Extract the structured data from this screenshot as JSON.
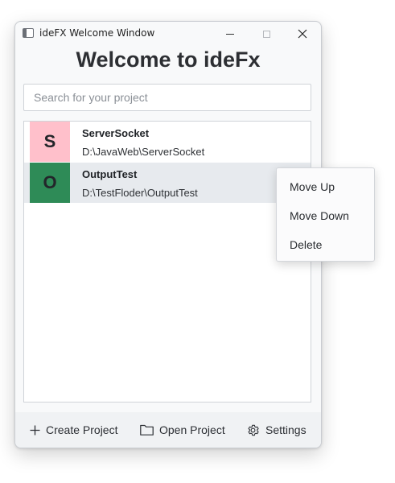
{
  "window": {
    "title": "ideFX Welcome Window",
    "heading": "Welcome to ideFx"
  },
  "search": {
    "placeholder": "Search for your project",
    "value": ""
  },
  "projects": [
    {
      "letter": "S",
      "name": "ServerSocket",
      "path": "D:\\JavaWeb\\ServerSocket",
      "color": "#ffc0cb"
    },
    {
      "letter": "O",
      "name": "OutputTest",
      "path": "D:\\TestFloder\\OutputTest",
      "color": "#2e8b57"
    }
  ],
  "context_menu": {
    "items": [
      "Move Up",
      "Move Down",
      "Delete"
    ]
  },
  "footer": {
    "create_label": "Create Project",
    "open_label": "Open Project",
    "settings_label": "Settings"
  },
  "icons": {
    "app": "app-window-icon",
    "create": "plus-icon",
    "open": "folder-icon",
    "settings": "gear-icon"
  }
}
